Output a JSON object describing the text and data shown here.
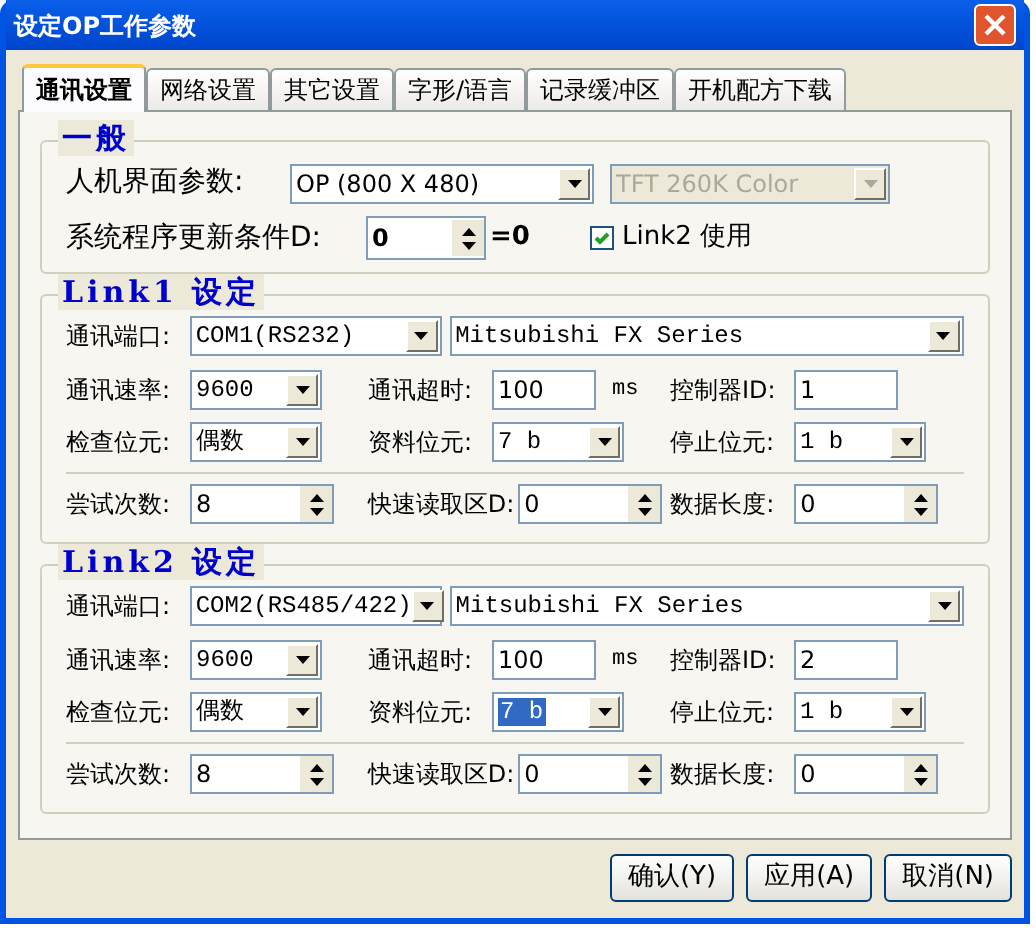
{
  "window": {
    "title": "设定OP工作参数"
  },
  "tabs": [
    {
      "label": "通讯设置",
      "selected": true
    },
    {
      "label": "网络设置",
      "selected": false
    },
    {
      "label": "其它设置",
      "selected": false
    },
    {
      "label": "字形/语言",
      "selected": false
    },
    {
      "label": "记录缓冲区",
      "selected": false
    },
    {
      "label": "开机配方下载",
      "selected": false
    }
  ],
  "general": {
    "title": "一般",
    "hmi_label": "人机界面参数:",
    "hmi_model": {
      "value": "OP (800 X 480)",
      "disabled": false
    },
    "display": {
      "value": "TFT 260K Color",
      "disabled": true
    },
    "update_label": "系统程序更新条件D:",
    "update_value": "0",
    "update_result": "=0",
    "link2_enable": {
      "label": "Link2 使用",
      "checked": true
    }
  },
  "links": [
    {
      "title": "Link1 设定",
      "port_label": "通讯端口:",
      "port": "COM1(RS232)",
      "driver": "Mitsubishi FX Series",
      "rows": [
        [
          {
            "kind": "select",
            "label": "通讯速率:",
            "value": "9600",
            "focused": false
          },
          {
            "kind": "text",
            "label": "通讯超时:",
            "value": "100",
            "unit": "ms"
          },
          {
            "kind": "text",
            "label": "控制器ID:",
            "value": "1"
          }
        ],
        [
          {
            "kind": "select",
            "label": "检查位元:",
            "value": "偶数",
            "focused": false
          },
          {
            "kind": "select",
            "label": "资料位元:",
            "value": "7 b",
            "focused": false
          },
          {
            "kind": "select",
            "label": "停止位元:",
            "value": "1 b",
            "focused": false
          }
        ],
        [
          {
            "kind": "spin",
            "label": "尝试次数:",
            "value": "8"
          },
          {
            "kind": "spin",
            "label": "快速读取区D:",
            "value": "0"
          },
          {
            "kind": "spin",
            "label": "数据长度:",
            "value": "0"
          }
        ]
      ]
    },
    {
      "title": "Link2 设定",
      "port_label": "通讯端口:",
      "port": "COM2(RS485/422)",
      "driver": "Mitsubishi FX Series",
      "rows": [
        [
          {
            "kind": "select",
            "label": "通讯速率:",
            "value": "9600",
            "focused": false
          },
          {
            "kind": "text",
            "label": "通讯超时:",
            "value": "100",
            "unit": "ms"
          },
          {
            "kind": "text",
            "label": "控制器ID:",
            "value": "2"
          }
        ],
        [
          {
            "kind": "select",
            "label": "检查位元:",
            "value": "偶数",
            "focused": false
          },
          {
            "kind": "select",
            "label": "资料位元:",
            "value": "7 b",
            "focused": true
          },
          {
            "kind": "select",
            "label": "停止位元:",
            "value": "1 b",
            "focused": false
          }
        ],
        [
          {
            "kind": "spin",
            "label": "尝试次数:",
            "value": "8"
          },
          {
            "kind": "spin",
            "label": "快速读取区D:",
            "value": "0"
          },
          {
            "kind": "spin",
            "label": "数据长度:",
            "value": "0"
          }
        ]
      ]
    }
  ],
  "buttons": [
    "确认(Y)",
    "应用(A)",
    "取消(N)"
  ]
}
